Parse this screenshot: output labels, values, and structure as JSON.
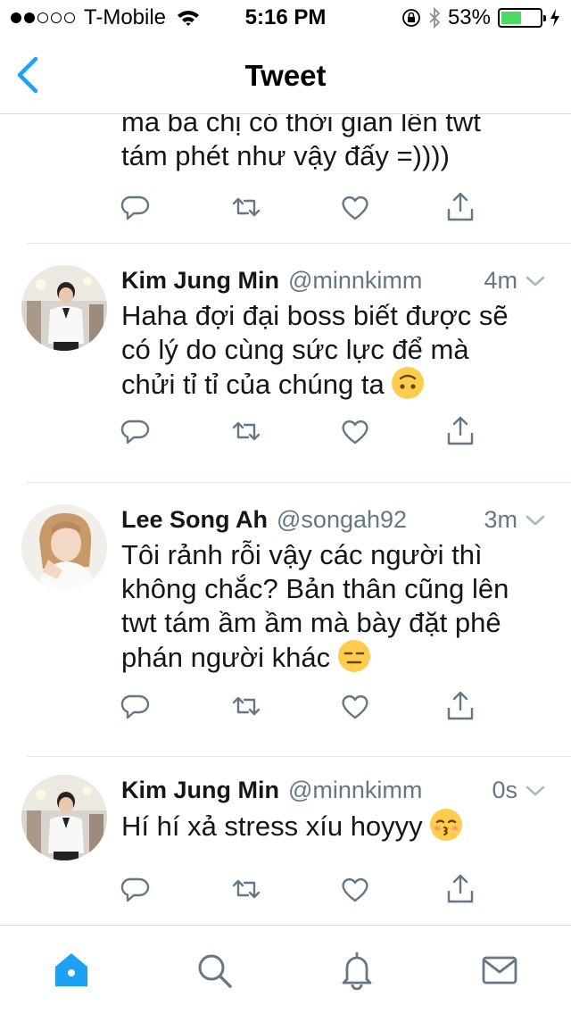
{
  "status_bar": {
    "carrier": "T-Mobile",
    "time": "5:16 PM",
    "battery": "53%",
    "battery_level": 0.53
  },
  "nav": {
    "title": "Tweet"
  },
  "top_tweet": {
    "text": "ma ba chị có thời gian lên twt\ntám phét như vậy đấy =))))"
  },
  "tweets": [
    {
      "name": "Kim Jung Min",
      "handle": "@minnkimm",
      "time": "4m",
      "text": "Haha đợi đại boss biết được sẽ\ncó lý do cùng sức lực để mà\nchửi tỉ tỉ của chúng ta",
      "emoji": "upside-down-face"
    },
    {
      "name": "Lee Song Ah",
      "handle": "@songah92",
      "time": "3m",
      "text": "Tôi rảnh rỗi vậy các người thì\nkhông chắc? Bản thân cũng lên\ntwt tám ầm ầm mà bày đặt phê\nphán người khác",
      "emoji": "expressionless-face"
    },
    {
      "name": "Kim Jung Min",
      "handle": "@minnkimm",
      "time": "0s",
      "text": "Hí hí xả stress xíu hoyyy",
      "emoji": "kissing-face"
    }
  ],
  "tab_bar": [
    "home-icon",
    "search-icon",
    "notifications-icon",
    "messages-icon"
  ],
  "colors": {
    "twitter_blue": "#1da1f2",
    "icon_gray": "#657786",
    "battery_green": "#4cd964"
  }
}
